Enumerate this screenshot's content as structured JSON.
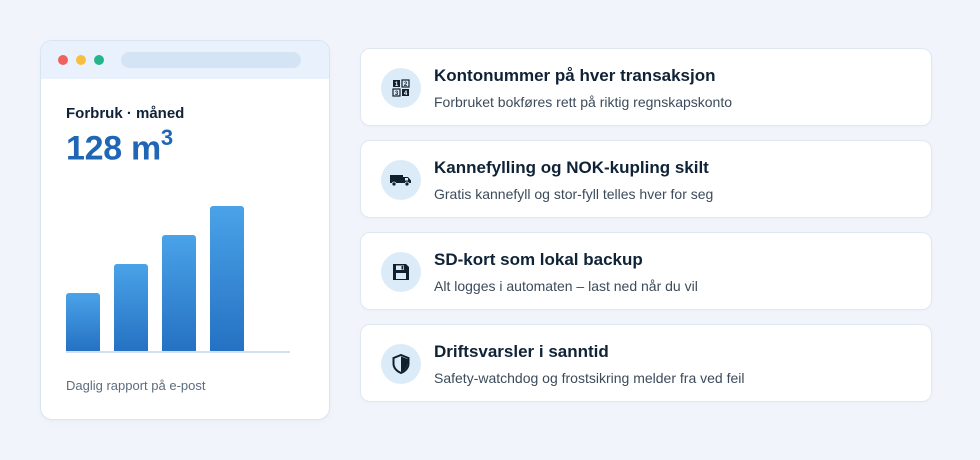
{
  "usage_card": {
    "label": "Forbruk · måned",
    "value": "128 m",
    "unit_exponent": "3",
    "footer": "Daglig rapport på e-post",
    "bar_color": "#2f80d0"
  },
  "chart_data": {
    "type": "bar",
    "categories": [
      "",
      "",
      "",
      ""
    ],
    "values": [
      4,
      6,
      8,
      10
    ],
    "title": "",
    "xlabel": "",
    "ylabel": "",
    "ylim": [
      0,
      11
    ]
  },
  "features": [
    {
      "title": "Kontonummer på hver transaksjon",
      "description": "Forbruket bokføres rett på riktig regnskapskonto",
      "icon": "numbers-icon"
    },
    {
      "title": "Kannefylling og NOK-kupling skilt",
      "description": "Gratis kannefyll og stor-fyll telles hver for seg",
      "icon": "truck-icon"
    },
    {
      "title": "SD-kort som lokal backup",
      "description": "Alt logges i automaten – last ned når du vil",
      "icon": "floppy-disk-icon"
    },
    {
      "title": "Driftsvarsler i sanntid",
      "description": "Safety-watchdog og frostsikring melder fra ved feil",
      "icon": "shield-icon"
    }
  ]
}
